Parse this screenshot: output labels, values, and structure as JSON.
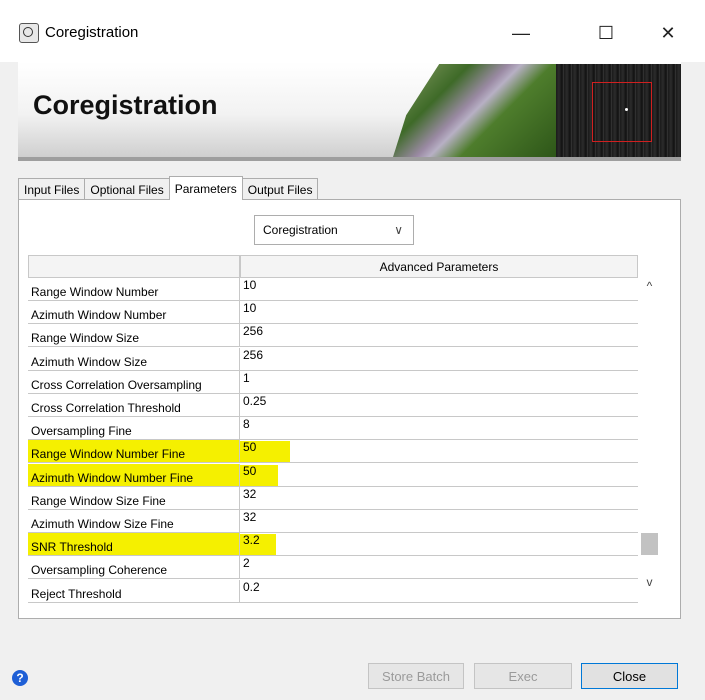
{
  "window": {
    "title": "Coregistration",
    "minimize": "—",
    "maximize": "☐",
    "close": "✕"
  },
  "banner": {
    "title": "Coregistration"
  },
  "tabs": [
    {
      "label": "Input Files",
      "active": false
    },
    {
      "label": "Optional Files",
      "active": false
    },
    {
      "label": "Parameters",
      "active": true
    },
    {
      "label": "Output Files",
      "active": false
    }
  ],
  "method_select": {
    "value": "Coregistration"
  },
  "table": {
    "headers": [
      "",
      "Advanced Parameters"
    ],
    "rows": [
      {
        "name": "Range Window Number",
        "value": "10"
      },
      {
        "name": "Azimuth Window Number",
        "value": "10"
      },
      {
        "name": "Range Window Size",
        "value": "256"
      },
      {
        "name": "Azimuth Window Size",
        "value": "256"
      },
      {
        "name": "Cross Correlation Oversampling",
        "value": "1"
      },
      {
        "name": "Cross Correlation Threshold",
        "value": "0.25"
      },
      {
        "name": "Oversampling Fine",
        "value": "8"
      },
      {
        "name": "Range Window Number Fine",
        "value": "50",
        "highlight": true
      },
      {
        "name": "Azimuth Window Number Fine",
        "value": "50",
        "highlight": true
      },
      {
        "name": "Range Window Size Fine",
        "value": "32"
      },
      {
        "name": "Azimuth Window Size Fine",
        "value": "32"
      },
      {
        "name": "SNR Threshold",
        "value": "3.2",
        "highlight": true
      },
      {
        "name": "Oversampling Coherence",
        "value": "2"
      },
      {
        "name": "Reject Threshold",
        "value": "0.2"
      }
    ]
  },
  "scrollbar": {
    "up": "^",
    "down": "v"
  },
  "buttons": {
    "store_batch": "Store Batch",
    "exec": "Exec",
    "close": "Close"
  },
  "help": {
    "glyph": "?"
  },
  "colors": {
    "highlight": "#f5f000",
    "help_blue": "#1e5fd6"
  }
}
